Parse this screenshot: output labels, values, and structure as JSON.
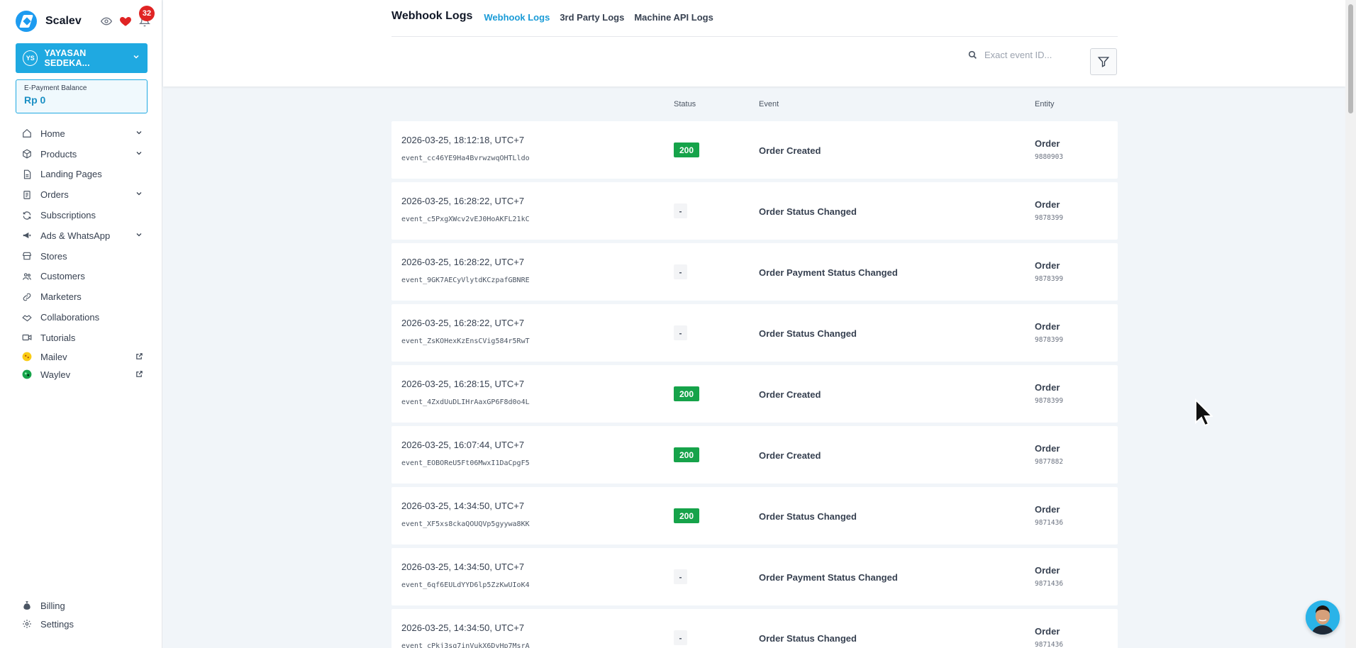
{
  "app": {
    "brand": "Scalev",
    "notification_count": "32",
    "org_initials": "YS",
    "org_name": "YAYASAN SEDEKA...",
    "balance_label": "E-Payment Balance",
    "balance_value": "Rp 0",
    "accent": "#1fa9e1"
  },
  "sidebar": {
    "items": [
      {
        "label": "Home",
        "icon": "home-icon",
        "expandable": true
      },
      {
        "label": "Products",
        "icon": "box-icon",
        "expandable": true
      },
      {
        "label": "Landing Pages",
        "icon": "document-icon",
        "expandable": false
      },
      {
        "label": "Orders",
        "icon": "clipboard-icon",
        "expandable": true
      },
      {
        "label": "Subscriptions",
        "icon": "refresh-icon",
        "expandable": false
      },
      {
        "label": "Ads & WhatsApp",
        "icon": "megaphone-icon",
        "expandable": true
      },
      {
        "label": "Stores",
        "icon": "store-icon",
        "expandable": false
      },
      {
        "label": "Customers",
        "icon": "users-icon",
        "expandable": false
      },
      {
        "label": "Marketers",
        "icon": "link-icon",
        "expandable": false
      },
      {
        "label": "Collaborations",
        "icon": "handshake-icon",
        "expandable": false
      },
      {
        "label": "Tutorials",
        "icon": "video-icon",
        "expandable": false
      },
      {
        "label": "Mailev",
        "icon": "mailev-logo-icon",
        "external": true
      },
      {
        "label": "Waylev",
        "icon": "waylev-logo-icon",
        "external": true
      }
    ],
    "bottom": [
      {
        "label": "Billing",
        "icon": "money-bag-icon"
      },
      {
        "label": "Settings",
        "icon": "gear-icon"
      }
    ]
  },
  "header": {
    "title": "Webhook Logs",
    "tabs": [
      {
        "label": "Webhook Logs",
        "active": true
      },
      {
        "label": "3rd Party Logs",
        "active": false
      },
      {
        "label": "Machine API Logs",
        "active": false
      }
    ],
    "search_placeholder": "Exact event ID..."
  },
  "table": {
    "columns": {
      "status": "Status",
      "event": "Event",
      "entity": "Entity"
    },
    "rows": [
      {
        "time": "2026-03-25, 18:12:18, UTC+7",
        "event_id": "event_cc46YE9Ha4BvrwzwqOHTLldo",
        "status": "200",
        "event": "Order Created",
        "entity": "Order",
        "entity_id": "9880903"
      },
      {
        "time": "2026-03-25, 16:28:22, UTC+7",
        "event_id": "event_c5PxgXWcv2vEJ0HoAKFL21kC",
        "status": "-",
        "event": "Order Status Changed",
        "entity": "Order",
        "entity_id": "9878399"
      },
      {
        "time": "2026-03-25, 16:28:22, UTC+7",
        "event_id": "event_9GK7AECyVlytdKCzpafGBNRE",
        "status": "-",
        "event": "Order Payment Status Changed",
        "entity": "Order",
        "entity_id": "9878399"
      },
      {
        "time": "2026-03-25, 16:28:22, UTC+7",
        "event_id": "event_ZsKOHexKzEnsCVig584r5RwT",
        "status": "-",
        "event": "Order Status Changed",
        "entity": "Order",
        "entity_id": "9878399"
      },
      {
        "time": "2026-03-25, 16:28:15, UTC+7",
        "event_id": "event_4ZxdUuDLIHrAaxGP6F8d0o4L",
        "status": "200",
        "event": "Order Created",
        "entity": "Order",
        "entity_id": "9878399"
      },
      {
        "time": "2026-03-25, 16:07:44, UTC+7",
        "event_id": "event_EOBOReU5Ft06MwxI1DaCpgF5",
        "status": "200",
        "event": "Order Created",
        "entity": "Order",
        "entity_id": "9877882"
      },
      {
        "time": "2026-03-25, 14:34:50, UTC+7",
        "event_id": "event_XF5xs8ckaQOUQVp5gyywa8KK",
        "status": "200",
        "event": "Order Status Changed",
        "entity": "Order",
        "entity_id": "9871436"
      },
      {
        "time": "2026-03-25, 14:34:50, UTC+7",
        "event_id": "event_6qf6EULdYYD6lp5ZzKwUIoK4",
        "status": "-",
        "event": "Order Payment Status Changed",
        "entity": "Order",
        "entity_id": "9871436"
      },
      {
        "time": "2026-03-25, 14:34:50, UTC+7",
        "event_id": "event_cPkj3sq7inVukX6DvHp7MsrA",
        "status": "-",
        "event": "Order Status Changed",
        "entity": "Order",
        "entity_id": "9871436"
      }
    ]
  }
}
